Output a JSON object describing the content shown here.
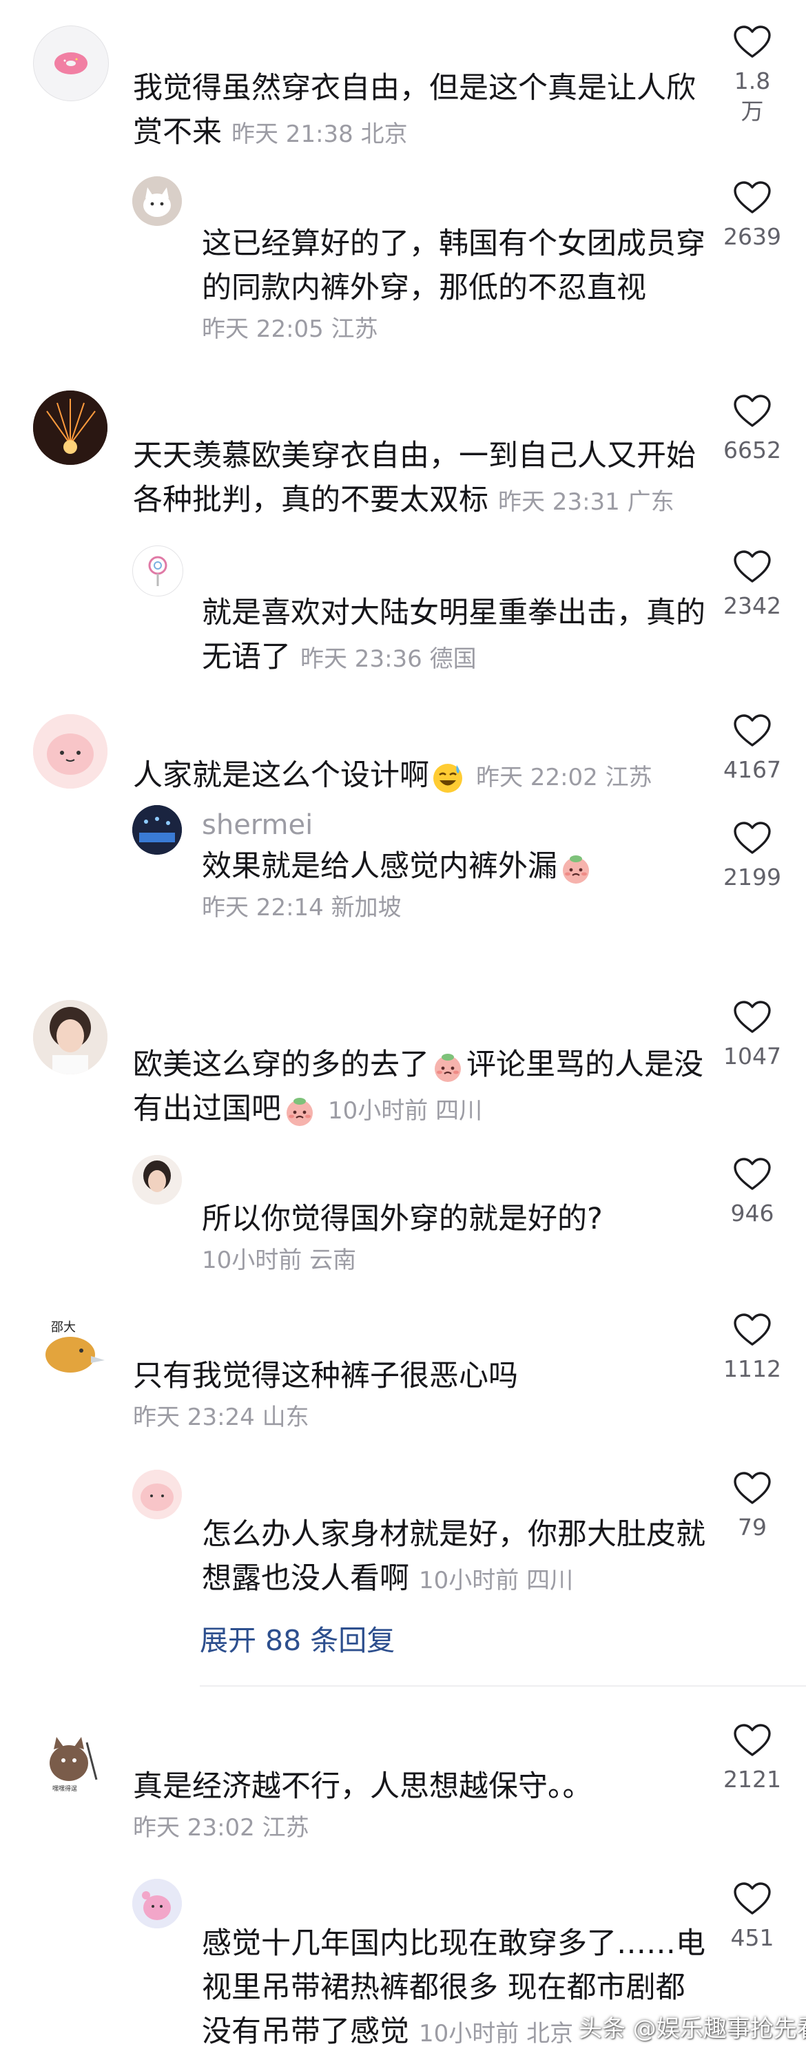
{
  "comments": [
    {
      "text": "我觉得虽然穿衣自由，但是这个真是让人欣赏不来",
      "meta": "昨天 21:38 北京",
      "likes": "1.8万"
    },
    {
      "text": "这已经算好的了，韩国有个女团成员穿的同款内裤外穿，那低的不忍直视",
      "meta": "昨天 22:05 江苏",
      "likes": "2639"
    },
    {
      "text": "天天羡慕欧美穿衣自由，一到自己人又开始各种批判，真的不要太双标",
      "meta": "昨天 23:31 广东",
      "likes": "6652"
    },
    {
      "text": "就是喜欢对大陆女明星重拳出击，真的无语了",
      "meta": "昨天 23:36 德国",
      "likes": "2342"
    },
    {
      "text": "人家就是这么个设计啊",
      "meta": "昨天 22:02 江苏",
      "likes": "4167"
    },
    {
      "username": "shermei",
      "text": "效果就是给人感觉内裤外漏",
      "meta": "昨天 22:14 新加坡",
      "likes": "2199"
    },
    {
      "text_a": "欧美这么穿的多的去了",
      "text_b": "评论里骂的人是没有出过国吧",
      "meta": "10小时前 四川",
      "likes": "1047"
    },
    {
      "text": "所以你觉得国外穿的就是好的?",
      "meta": "10小时前 云南",
      "likes": "946"
    },
    {
      "text": "只有我觉得这种裤子很恶心吗",
      "meta": "昨天 23:24 山东",
      "likes": "1112"
    },
    {
      "text": "怎么办人家身材就是好，你那大肚皮就想露也没人看啊",
      "meta": "10小时前 四川",
      "likes": "79"
    },
    {
      "text": "真是经济越不行，人思想越保守。。",
      "meta": "昨天 23:02 江苏",
      "likes": "2121"
    },
    {
      "text": "感觉十几年国内比现在敢穿多了……电视里吊带裙热裤都很多 现在都市剧都没有吊带了感觉",
      "meta": "10小时前 北京",
      "likes": "451"
    }
  ],
  "expand_replies": "展开 88 条回复",
  "avatar_labels": {
    "duck": "邵大",
    "cat": "嘿嘿得逞"
  },
  "watermark": "头条 @娱乐趣事抢先看",
  "colors": {
    "meta": "#9c9ca4",
    "link": "#2d4f8e",
    "text": "#16161a"
  }
}
